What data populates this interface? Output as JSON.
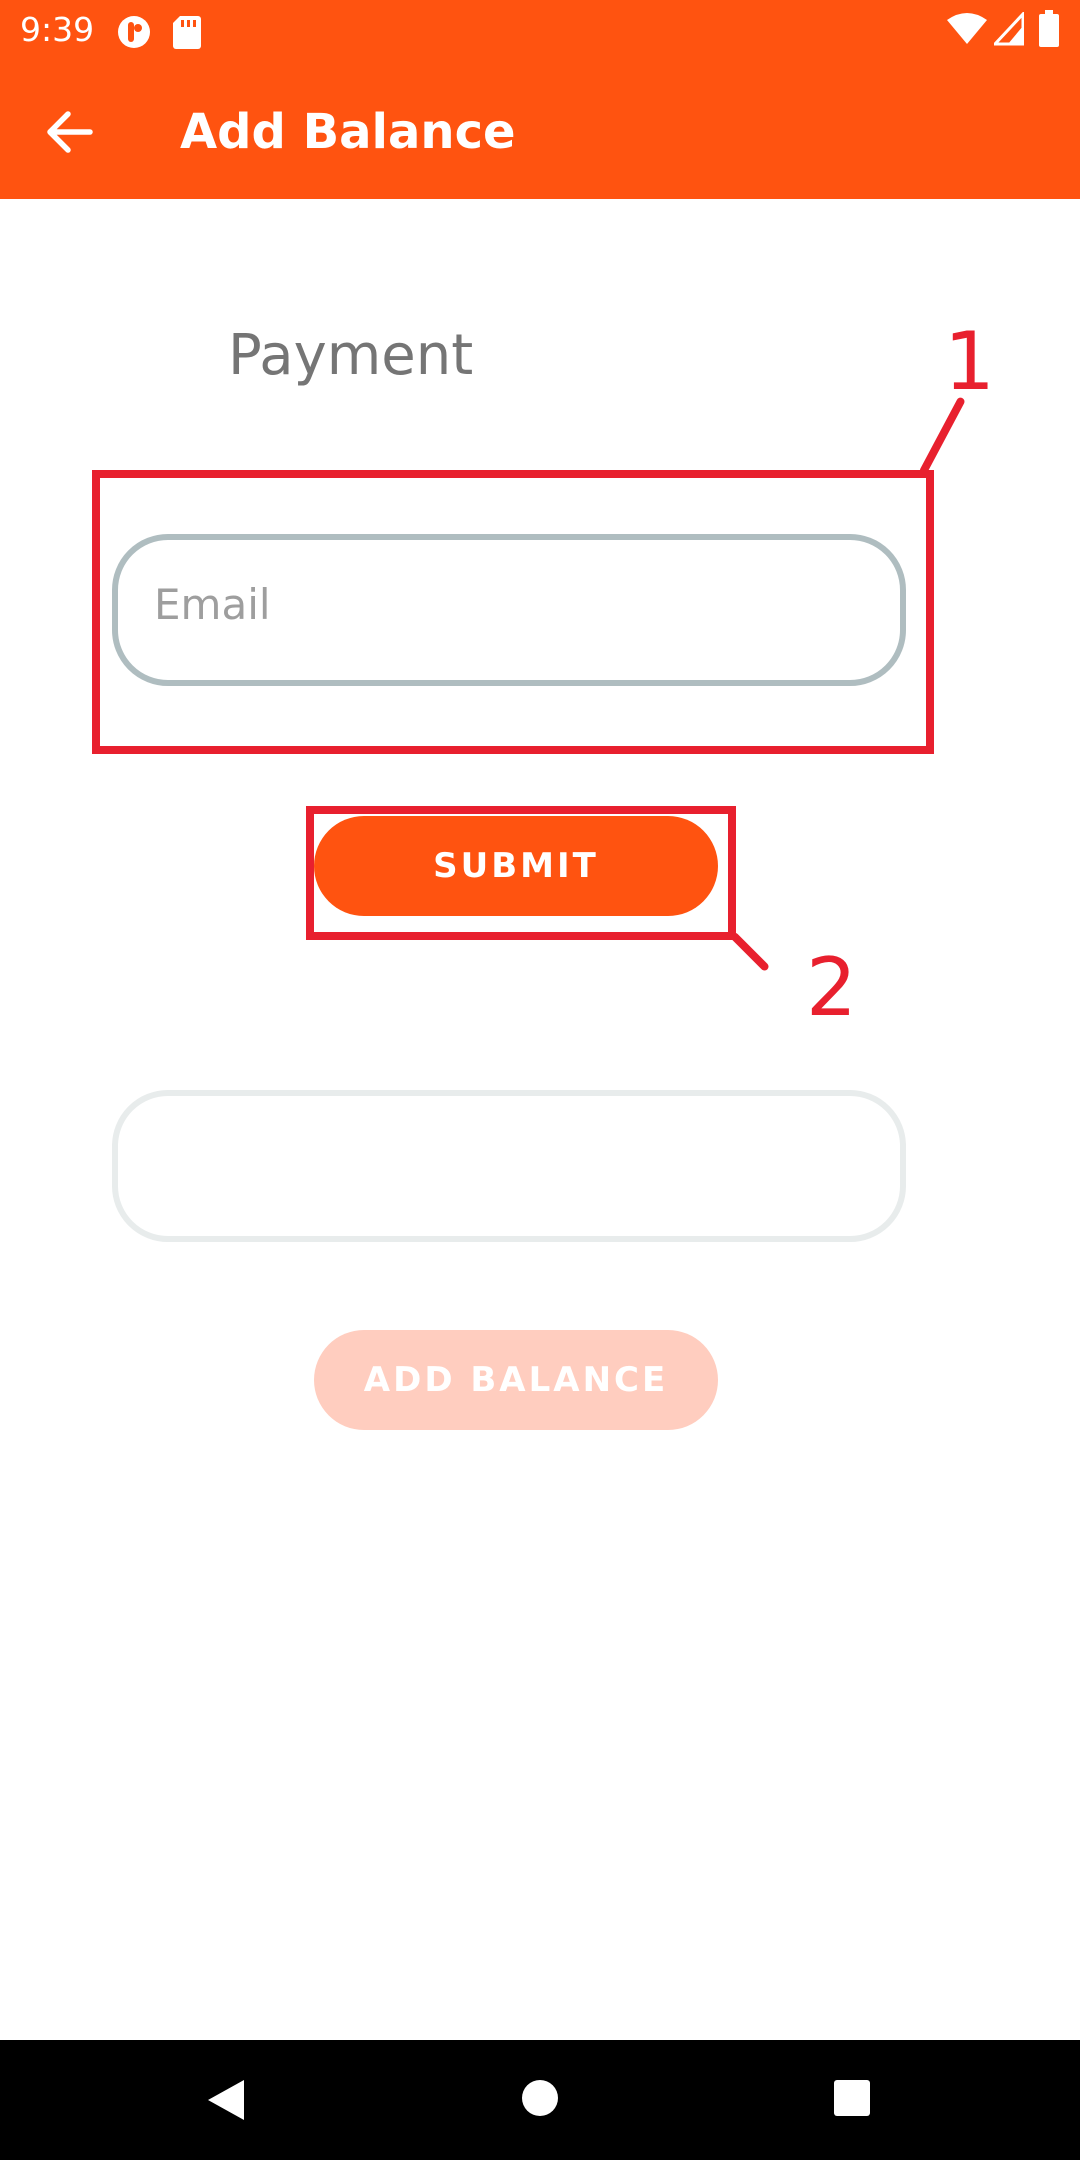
{
  "status": {
    "time": "9:39"
  },
  "appbar": {
    "title": "Add Balance"
  },
  "content": {
    "section_title": "Payment",
    "email_placeholder": "Email",
    "submit_label": "SUBMIT",
    "add_balance_label": "ADD BALANCE"
  },
  "annotations": {
    "one": "1",
    "two": "2"
  },
  "colors": {
    "brand": "#FF5310",
    "brand_disabled": "#FFCDBF",
    "annotation": "#E8202E"
  },
  "icons": {
    "back": "arrow-left",
    "nav_back": "triangle-left",
    "nav_home": "circle",
    "nav_recents": "square"
  }
}
